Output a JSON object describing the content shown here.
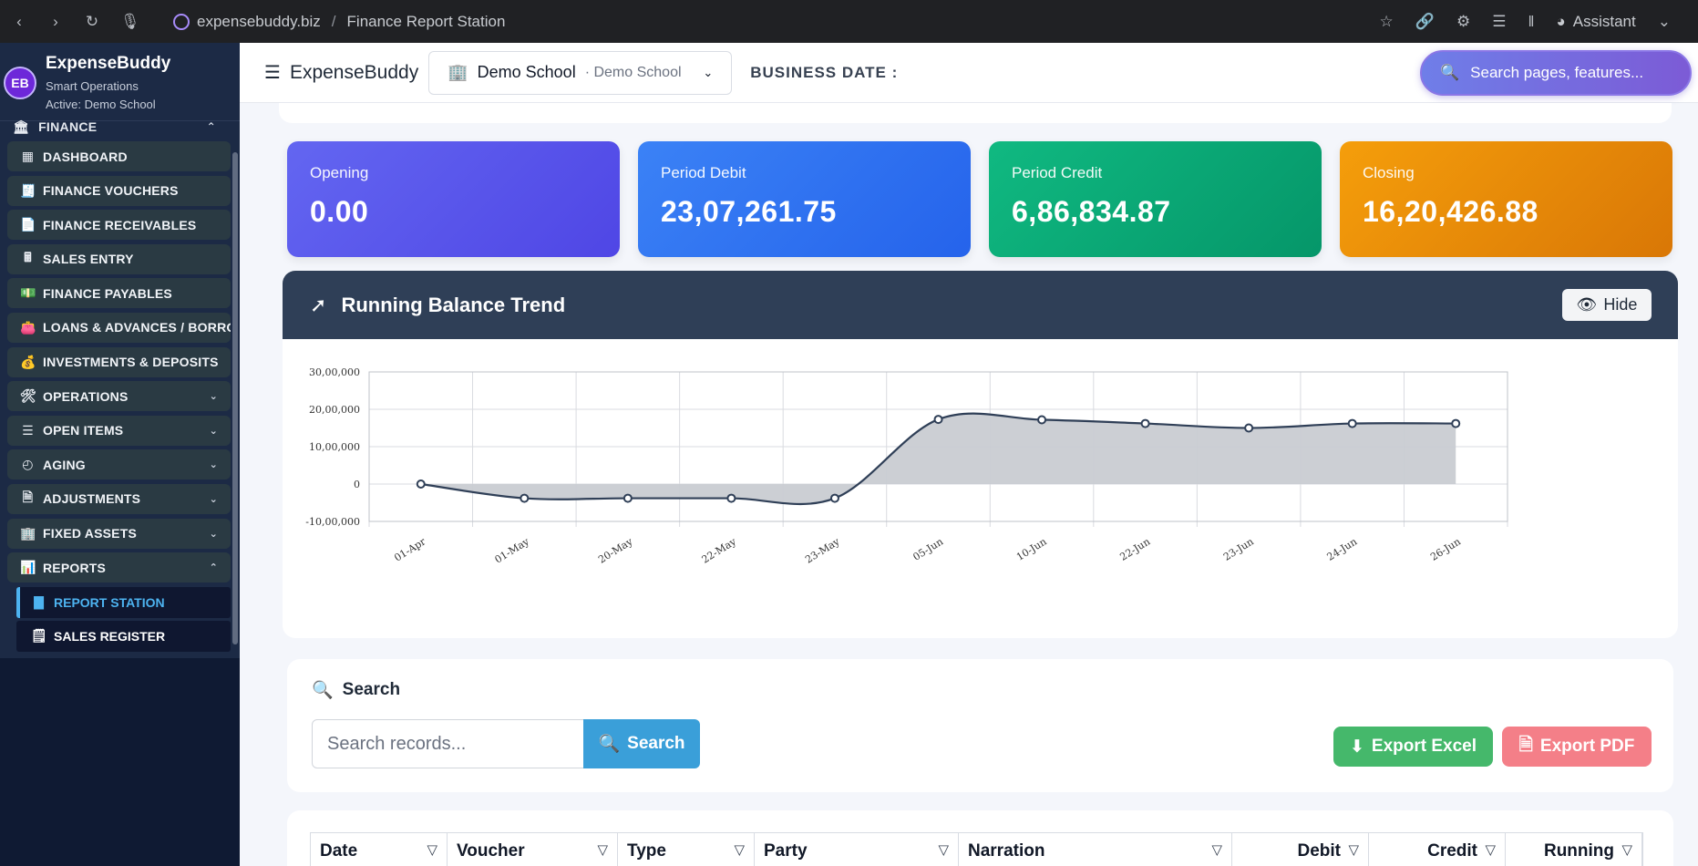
{
  "browser": {
    "url_domain": "expensebuddy.biz",
    "url_path": "Finance Report Station",
    "url_sep": "/",
    "assistant_label": "Assistant"
  },
  "sidebar": {
    "brand": {
      "logo_text": "EB",
      "name": "ExpenseBuddy",
      "subtitle": "Smart Operations",
      "active": "Active: Demo School"
    },
    "section": "FINANCE",
    "items": [
      {
        "label": "DASHBOARD",
        "icon": "dashboard-icon"
      },
      {
        "label": "FINANCE VOUCHERS",
        "icon": "receipt-icon"
      },
      {
        "label": "FINANCE RECEIVABLES",
        "icon": "file-invoice-icon"
      },
      {
        "label": "SALES ENTRY",
        "icon": "cash-register-icon"
      },
      {
        "label": "FINANCE PAYABLES",
        "icon": "money-bill-icon"
      },
      {
        "label": "LOANS & ADVANCES / BORRO",
        "icon": "wallet-icon"
      },
      {
        "label": "INVESTMENTS & DEPOSITS",
        "icon": "piggy-bank-icon"
      },
      {
        "label": "OPERATIONS",
        "icon": "tools-icon",
        "expandable": true
      },
      {
        "label": "OPEN ITEMS",
        "icon": "list-icon",
        "expandable": true
      },
      {
        "label": "AGING",
        "icon": "clock-icon",
        "expandable": true
      },
      {
        "label": "ADJUSTMENTS",
        "icon": "file-plus-icon",
        "expandable": true
      },
      {
        "label": "FIXED ASSETS",
        "icon": "building-icon",
        "expandable": true
      },
      {
        "label": "REPORTS",
        "icon": "chart-bar-icon",
        "expanded": true
      }
    ],
    "sub_items": [
      {
        "label": "REPORT STATION",
        "icon": "chart-column-icon",
        "active": true
      },
      {
        "label": "SALES REGISTER",
        "icon": "register-icon"
      }
    ]
  },
  "topbar": {
    "app_name": "ExpenseBuddy",
    "school": "Demo School",
    "school_sub": "· Demo School",
    "business_date_label": "BUSINESS DATE :",
    "search_placeholder": "Search pages, features..."
  },
  "stats": [
    {
      "label": "Opening",
      "value": "0.00"
    },
    {
      "label": "Period Debit",
      "value": "23,07,261.75"
    },
    {
      "label": "Period Credit",
      "value": "6,86,834.87"
    },
    {
      "label": "Closing",
      "value": "16,20,426.88"
    }
  ],
  "chart_card": {
    "title": "Running Balance Trend",
    "hide_label": "Hide"
  },
  "chart_data": {
    "type": "area",
    "title": "",
    "xlabel": "",
    "ylabel": "",
    "categories": [
      "01-Apr",
      "01-May",
      "20-May",
      "22-May",
      "23-May",
      "05-Jun",
      "10-Jun",
      "22-Jun",
      "23-Jun",
      "24-Jun",
      "26-Jun"
    ],
    "point_x": [
      0.5,
      1.5,
      2.5,
      3.5,
      4.5,
      5.5,
      6.5,
      7.5,
      8.5,
      9.5,
      10.5
    ],
    "point_y": [
      0,
      -380000,
      -380000,
      -380000,
      -380000,
      1730000,
      1720000,
      1620000,
      1500000,
      1620000,
      1620000
    ],
    "ylim": [
      -1000000,
      3000000
    ],
    "yticks": [
      -1000000,
      0,
      1000000,
      2000000,
      3000000
    ],
    "ytick_labels": [
      "-10,00,000",
      "0",
      "10,00,000",
      "20,00,000",
      "30,00,000"
    ],
    "grid": true,
    "line_color": "#2f3f57",
    "fill_color": "#c9ccd2"
  },
  "search": {
    "title": "Search",
    "placeholder": "Search records...",
    "button": "Search",
    "export_excel": "Export Excel",
    "export_pdf": "Export PDF"
  },
  "table": {
    "columns": [
      "Date",
      "Voucher",
      "Type",
      "Party",
      "Narration",
      "Debit",
      "Credit",
      "Running"
    ]
  }
}
